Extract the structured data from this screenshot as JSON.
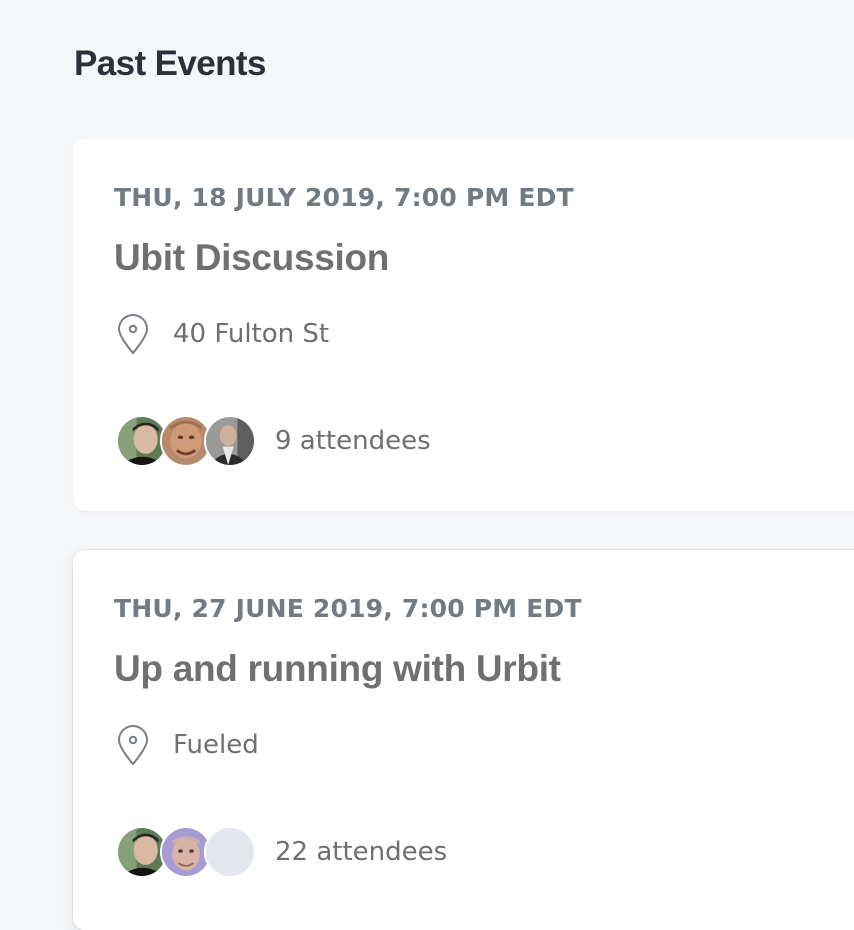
{
  "section": {
    "title": "Past Events"
  },
  "events": [
    {
      "date": "THU, 18 JULY 2019, 7:00 PM EDT",
      "title": "Ubit Discussion",
      "location": "40 Fulton St",
      "attendees_label": "9 attendees"
    },
    {
      "date": "THU, 27 JUNE 2019, 7:00 PM EDT",
      "title": "Up and running with Urbit",
      "location": "Fueled",
      "attendees_label": "22 attendees"
    }
  ],
  "icons": {
    "location": "map-pin-icon"
  },
  "colors": {
    "background": "#f5f6f8",
    "card": "#ffffff",
    "date_text": "#737a82",
    "title_text": "#707070",
    "heading_text": "#2e3039",
    "placeholder_avatar": "#e3e6eb"
  }
}
